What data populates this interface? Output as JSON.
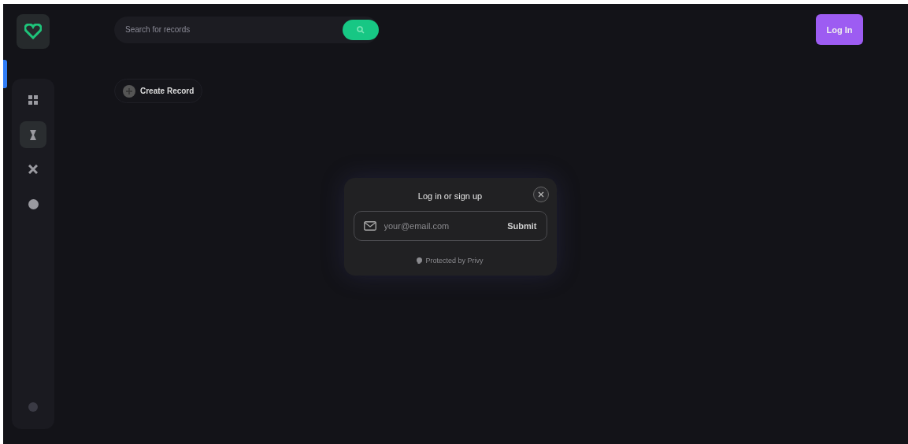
{
  "sidebar": {
    "items": [
      {
        "selected": false
      },
      {
        "selected": true
      },
      {
        "selected": false
      },
      {
        "selected": false
      }
    ]
  },
  "search": {
    "placeholder": "Search for records"
  },
  "create_button": {
    "label": "Create Record"
  },
  "login_button": {
    "label": "Log In"
  },
  "modal": {
    "title": "Log in or sign up",
    "email": {
      "placeholder": "your@email.com"
    },
    "submit": "Submit",
    "footer": "Protected by Privy"
  }
}
